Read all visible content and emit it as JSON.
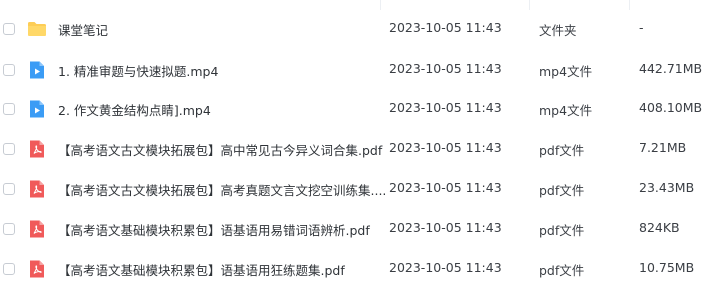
{
  "files": [
    {
      "icon": "folder-icon",
      "name": "课堂笔记",
      "modified": "2023-10-05 11:43",
      "type": "文件夹",
      "size": "-"
    },
    {
      "icon": "video-icon",
      "name": "1. 精准审题与快速拟题.mp4",
      "modified": "2023-10-05 11:43",
      "type": "mp4文件",
      "size": "442.71MB"
    },
    {
      "icon": "video-icon",
      "name": "2. 作文黄金结构点睛].mp4",
      "modified": "2023-10-05 11:43",
      "type": "mp4文件",
      "size": "408.10MB"
    },
    {
      "icon": "pdf-icon",
      "name": "【高考语文古文模块拓展包】高中常见古今异义词合集.pdf",
      "modified": "2023-10-05 11:43",
      "type": "pdf文件",
      "size": "7.21MB"
    },
    {
      "icon": "pdf-icon",
      "name": "【高考语文古文模块拓展包】高考真题文言文挖空训练集....",
      "modified": "2023-10-05 11:43",
      "type": "pdf文件",
      "size": "23.43MB"
    },
    {
      "icon": "pdf-icon",
      "name": "【高考语文基础模块积累包】语基语用易错词语辨析.pdf",
      "modified": "2023-10-05 11:43",
      "type": "pdf文件",
      "size": "824KB"
    },
    {
      "icon": "pdf-icon",
      "name": "【高考语文基础模块积累包】语基语用狂练题集.pdf",
      "modified": "2023-10-05 11:43",
      "type": "pdf文件",
      "size": "10.75MB"
    }
  ],
  "colors": {
    "folder": "#fdcd56",
    "video": "#3b9cf5",
    "pdf": "#f05a5a"
  }
}
